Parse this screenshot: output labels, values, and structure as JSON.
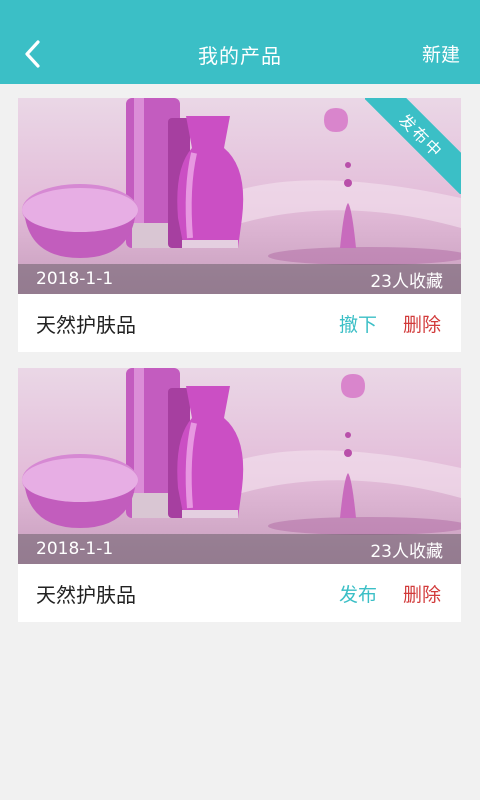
{
  "header": {
    "back_icon": "chevron-left-icon",
    "title": "我的产品",
    "new_label": "新建"
  },
  "colors": {
    "header": "#3bbfc6",
    "primary_action": "#3bbfc6",
    "danger_action": "#d23b3b",
    "background": "#f1f1f1"
  },
  "products": [
    {
      "status_badge": "发布中",
      "date": "2018-1-1",
      "favorites": "23人收藏",
      "name": "天然护肤品",
      "primary_action": "撤下",
      "delete_action": "删除"
    },
    {
      "date": "2018-1-1",
      "favorites": "23人收藏",
      "name": "天然护肤品",
      "primary_action": "发布",
      "delete_action": "删除"
    }
  ]
}
